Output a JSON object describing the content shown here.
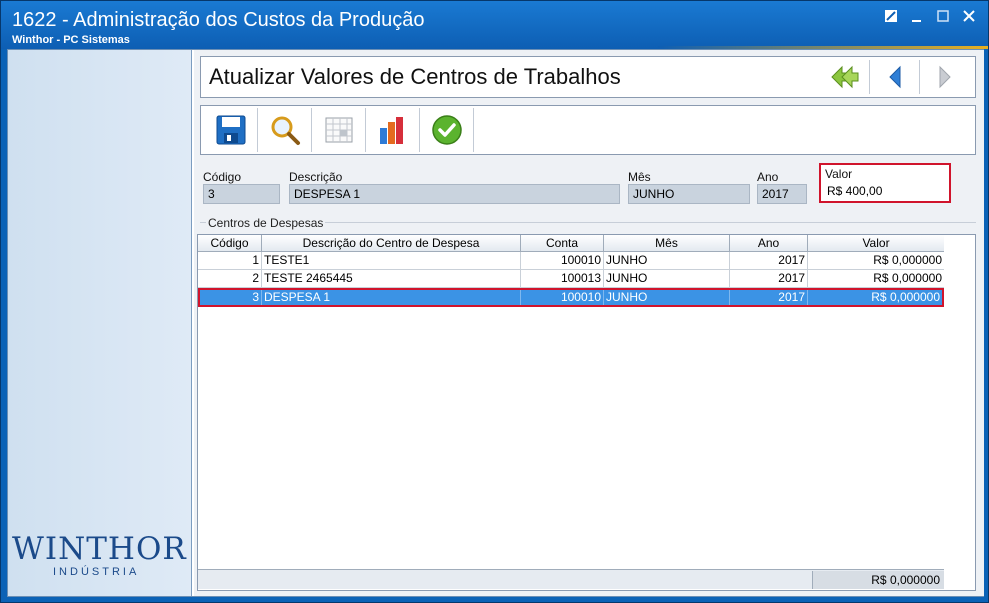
{
  "window": {
    "title": "1622 - Administração dos Custos da Produção",
    "subtitle": "Winthor - PC Sistemas",
    "controls": [
      "restore-icon",
      "minimize-icon",
      "maximize-icon",
      "close-icon"
    ]
  },
  "sidebar": {
    "logo_main": "WINTHOR",
    "logo_sub": "INDÚSTRIA"
  },
  "header": {
    "title": "Atualizar Valores de Centros de Trabalhos",
    "nav": [
      "first-icon",
      "previous-icon",
      "next-icon"
    ]
  },
  "toolbar": {
    "buttons": [
      "save-icon",
      "search-icon",
      "calendar-icon",
      "chart-icon",
      "confirm-icon"
    ]
  },
  "fields": {
    "codigo_label": "Código",
    "codigo_value": "3",
    "descricao_label": "Descrição",
    "descricao_value": "DESPESA 1",
    "mes_label": "Mês",
    "mes_value": "JUNHO",
    "ano_label": "Ano",
    "ano_value": "2017",
    "valor_label": "Valor",
    "valor_value": "R$ 400,00"
  },
  "grid": {
    "group_label": "Centros de Despesas",
    "columns": [
      "Código",
      "Descrição do Centro de Despesa",
      "Conta",
      "Mês",
      "Ano",
      "Valor"
    ],
    "rows": [
      [
        "1",
        "TESTE1",
        "100010",
        "JUNHO",
        "2017",
        "R$ 0,000000"
      ],
      [
        "2",
        "TESTE 2465445",
        "100013",
        "JUNHO",
        "2017",
        "R$ 0,000000"
      ],
      [
        "3",
        "DESPESA 1",
        "100010",
        "JUNHO",
        "2017",
        "R$ 0,000000"
      ]
    ],
    "selected_row": 3,
    "footer_total": "R$ 0,000000"
  },
  "colors": {
    "title_bar": "#1a7ad3",
    "selection": "#3b93e5",
    "highlight_border": "#d0142c"
  }
}
